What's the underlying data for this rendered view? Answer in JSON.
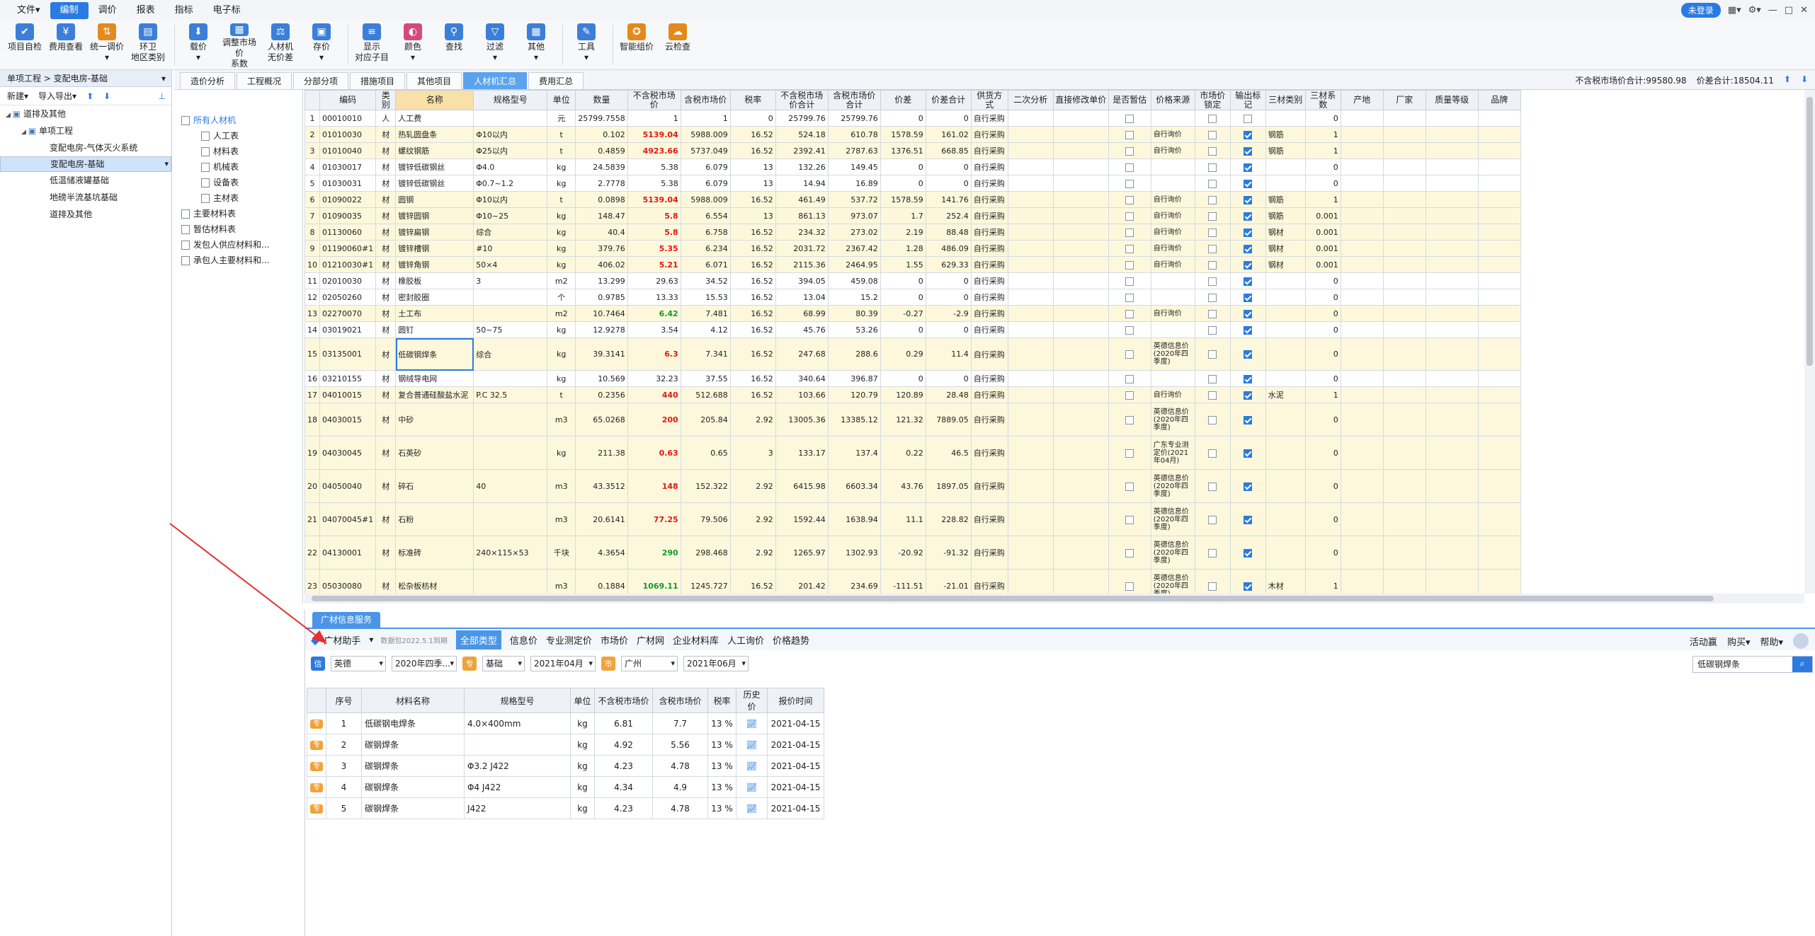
{
  "menubar": {
    "items": [
      "文件▾",
      "编制",
      "调价",
      "报表",
      "指标",
      "电子标"
    ],
    "active_index": 1,
    "login": "未登录"
  },
  "ribbon": {
    "buttons": [
      {
        "label": "项目自检",
        "icon": "check-icon",
        "color": "#3b7fd8"
      },
      {
        "label": "费用查看",
        "icon": "cost-icon",
        "color": "#3b7fd8"
      },
      {
        "label": "统一调价\n▾",
        "icon": "price-adjust-icon",
        "color": "#e28a1e"
      },
      {
        "label": "环卫\n地区类别",
        "icon": "region-icon",
        "color": "#3b7fd8"
      },
      {
        "label": "载价\n▾",
        "icon": "load-price-icon",
        "color": "#3b7fd8"
      },
      {
        "label": "调整市场价\n系数",
        "icon": "coefficient-icon",
        "color": "#3b7fd8"
      },
      {
        "label": "人材机\n无价差",
        "icon": "scale-icon",
        "color": "#3b7fd8"
      },
      {
        "label": "存价\n▾",
        "icon": "save-price-icon",
        "color": "#3b7fd8"
      },
      {
        "label": "显示\n对应子目",
        "icon": "display-icon",
        "color": "#3b7fd8"
      },
      {
        "label": "颜色\n▾",
        "icon": "color-icon",
        "color": "#d64a7a"
      },
      {
        "label": "查找",
        "icon": "binoculars-icon",
        "color": "#3b7fd8"
      },
      {
        "label": "过滤\n▾",
        "icon": "filter-icon",
        "color": "#3b7fd8"
      },
      {
        "label": "其他\n▾",
        "icon": "other-icon",
        "color": "#3b7fd8"
      },
      {
        "label": "工具\n▾",
        "icon": "tool-icon",
        "color": "#3b7fd8"
      },
      {
        "label": "智能组价",
        "icon": "smart-price-icon",
        "color": "#e28a1e"
      },
      {
        "label": "云检查",
        "icon": "cloud-check-icon",
        "color": "#e28a1e"
      }
    ]
  },
  "left": {
    "header": "单项工程 > 变配电房-基础",
    "tools": [
      "新建▾",
      "导入导出▾"
    ],
    "tree": [
      {
        "label": "道排及其他",
        "level": 0,
        "selected": false
      },
      {
        "label": "单项工程",
        "level": 1,
        "selected": false
      },
      {
        "label": "变配电房-气体灭火系统",
        "level": 2,
        "selected": false
      },
      {
        "label": "变配电房-基础",
        "level": 2,
        "selected": true
      },
      {
        "label": "低温储液罐基础",
        "level": 2,
        "selected": false
      },
      {
        "label": "地磅半流基坑基础",
        "level": 2,
        "selected": false
      },
      {
        "label": "道排及其他",
        "level": 2,
        "selected": false
      }
    ]
  },
  "tabs": {
    "items": [
      "造价分析",
      "工程概况",
      "分部分项",
      "措施项目",
      "其他项目",
      "人材机汇总",
      "费用汇总"
    ],
    "active_index": 5,
    "summary1": "不含税市场价合计:99580.98",
    "summary2": "价差合计:18504.11"
  },
  "midtree": [
    {
      "label": "所有人材机",
      "level": 0
    },
    {
      "label": "人工表",
      "level": 1
    },
    {
      "label": "材料表",
      "level": 1
    },
    {
      "label": "机械表",
      "level": 1
    },
    {
      "label": "设备表",
      "level": 1
    },
    {
      "label": "主材表",
      "level": 1
    },
    {
      "label": "主要材料表",
      "level": 0
    },
    {
      "label": "暂估材料表",
      "level": 0
    },
    {
      "label": "发包人供应材料和...",
      "level": 0
    },
    {
      "label": "承包人主要材料和...",
      "level": 0
    }
  ],
  "grid": {
    "headers": [
      "",
      "编码",
      "类别",
      "名称",
      "规格型号",
      "单位",
      "数量",
      "不含税市场价",
      "含税市场价",
      "税率",
      "不含税市场价合计",
      "含税市场价合计",
      "价差",
      "价差合计",
      "供货方式",
      "二次分析",
      "直接修改单价",
      "是否暂估",
      "价格来源",
      "市场价锁定",
      "输出标记",
      "三材类别",
      "三材系数",
      "产地",
      "厂家",
      "质量等级",
      "品牌"
    ],
    "rows": [
      {
        "n": "1",
        "code": "00010010",
        "cat": "人",
        "name": "人工费",
        "spec": "",
        "unit": "元",
        "qty": "25799.7558",
        "p1": "1",
        "p1c": "",
        "p2": "1",
        "tax": "0",
        "s1": "25799.76",
        "s2": "25799.76",
        "d": "0",
        "dt": "0",
        "sup": "自行采购",
        "src": "",
        "flag": false,
        "mat": "",
        "coef": "0",
        "y": false,
        "h": 23
      },
      {
        "n": "2",
        "code": "01010030",
        "cat": "材",
        "name": "热轧圆盘条",
        "spec": "Φ10以内",
        "unit": "t",
        "qty": "0.102",
        "p1": "5139.04",
        "p1c": "red",
        "p2": "5988.009",
        "tax": "16.52",
        "s1": "524.18",
        "s2": "610.78",
        "d": "1578.59",
        "dt": "161.02",
        "sup": "自行采购",
        "src": "自行询价",
        "flag": true,
        "mat": "钢筋",
        "coef": "1",
        "y": true,
        "h": 23
      },
      {
        "n": "3",
        "code": "01010040",
        "cat": "材",
        "name": "螺纹钢筋",
        "spec": "Φ25以内",
        "unit": "t",
        "qty": "0.4859",
        "p1": "4923.66",
        "p1c": "red",
        "p2": "5737.049",
        "tax": "16.52",
        "s1": "2392.41",
        "s2": "2787.63",
        "d": "1376.51",
        "dt": "668.85",
        "sup": "自行采购",
        "src": "自行询价",
        "flag": true,
        "mat": "钢筋",
        "coef": "1",
        "y": true,
        "h": 23
      },
      {
        "n": "4",
        "code": "01030017",
        "cat": "材",
        "name": "镀锌低碳钢丝",
        "spec": "Φ4.0",
        "unit": "kg",
        "qty": "24.5839",
        "p1": "5.38",
        "p1c": "",
        "p2": "6.079",
        "tax": "13",
        "s1": "132.26",
        "s2": "149.45",
        "d": "0",
        "dt": "0",
        "sup": "自行采购",
        "src": "",
        "flag": true,
        "mat": "",
        "coef": "0",
        "y": false,
        "h": 23
      },
      {
        "n": "5",
        "code": "01030031",
        "cat": "材",
        "name": "镀锌低碳钢丝",
        "spec": "Φ0.7~1.2",
        "unit": "kg",
        "qty": "2.7778",
        "p1": "5.38",
        "p1c": "",
        "p2": "6.079",
        "tax": "13",
        "s1": "14.94",
        "s2": "16.89",
        "d": "0",
        "dt": "0",
        "sup": "自行采购",
        "src": "",
        "flag": true,
        "mat": "",
        "coef": "0",
        "y": false,
        "h": 23
      },
      {
        "n": "6",
        "code": "01090022",
        "cat": "材",
        "name": "圆钢",
        "spec": "Φ10以内",
        "unit": "t",
        "qty": "0.0898",
        "p1": "5139.04",
        "p1c": "red",
        "p2": "5988.009",
        "tax": "16.52",
        "s1": "461.49",
        "s2": "537.72",
        "d": "1578.59",
        "dt": "141.76",
        "sup": "自行采购",
        "src": "自行询价",
        "flag": true,
        "mat": "钢筋",
        "coef": "1",
        "y": true,
        "h": 23
      },
      {
        "n": "7",
        "code": "01090035",
        "cat": "材",
        "name": "镀锌圆钢",
        "spec": "Φ10~25",
        "unit": "kg",
        "qty": "148.47",
        "p1": "5.8",
        "p1c": "red",
        "p2": "6.554",
        "tax": "13",
        "s1": "861.13",
        "s2": "973.07",
        "d": "1.7",
        "dt": "252.4",
        "sup": "自行采购",
        "src": "自行询价",
        "flag": true,
        "mat": "钢筋",
        "coef": "0.001",
        "y": true,
        "h": 23
      },
      {
        "n": "8",
        "code": "01130060",
        "cat": "材",
        "name": "镀锌扁钢",
        "spec": "综合",
        "unit": "kg",
        "qty": "40.4",
        "p1": "5.8",
        "p1c": "red",
        "p2": "6.758",
        "tax": "16.52",
        "s1": "234.32",
        "s2": "273.02",
        "d": "2.19",
        "dt": "88.48",
        "sup": "自行采购",
        "src": "自行询价",
        "flag": true,
        "mat": "钢材",
        "coef": "0.001",
        "y": true,
        "h": 23
      },
      {
        "n": "9",
        "code": "01190060#1",
        "cat": "材",
        "name": "镀锌槽钢",
        "spec": "#10",
        "unit": "kg",
        "qty": "379.76",
        "p1": "5.35",
        "p1c": "red",
        "p2": "6.234",
        "tax": "16.52",
        "s1": "2031.72",
        "s2": "2367.42",
        "d": "1.28",
        "dt": "486.09",
        "sup": "自行采购",
        "src": "自行询价",
        "flag": true,
        "mat": "钢材",
        "coef": "0.001",
        "y": true,
        "h": 23
      },
      {
        "n": "10",
        "code": "01210030#1",
        "cat": "材",
        "name": "镀锌角钢",
        "spec": "50×4",
        "unit": "kg",
        "qty": "406.02",
        "p1": "5.21",
        "p1c": "red",
        "p2": "6.071",
        "tax": "16.52",
        "s1": "2115.36",
        "s2": "2464.95",
        "d": "1.55",
        "dt": "629.33",
        "sup": "自行采购",
        "src": "自行询价",
        "flag": true,
        "mat": "钢材",
        "coef": "0.001",
        "y": true,
        "h": 23
      },
      {
        "n": "11",
        "code": "02010030",
        "cat": "材",
        "name": "橡胶板",
        "spec": "3",
        "unit": "m2",
        "qty": "13.299",
        "p1": "29.63",
        "p1c": "",
        "p2": "34.52",
        "tax": "16.52",
        "s1": "394.05",
        "s2": "459.08",
        "d": "0",
        "dt": "0",
        "sup": "自行采购",
        "src": "",
        "flag": true,
        "mat": "",
        "coef": "0",
        "y": false,
        "h": 23
      },
      {
        "n": "12",
        "code": "02050260",
        "cat": "材",
        "name": "密封胶圈",
        "spec": "",
        "unit": "个",
        "qty": "0.9785",
        "p1": "13.33",
        "p1c": "",
        "p2": "15.53",
        "tax": "16.52",
        "s1": "13.04",
        "s2": "15.2",
        "d": "0",
        "dt": "0",
        "sup": "自行采购",
        "src": "",
        "flag": true,
        "mat": "",
        "coef": "0",
        "y": false,
        "h": 23
      },
      {
        "n": "13",
        "code": "02270070",
        "cat": "材",
        "name": "土工布",
        "spec": "",
        "unit": "m2",
        "qty": "10.7464",
        "p1": "6.42",
        "p1c": "green",
        "p2": "7.481",
        "tax": "16.52",
        "s1": "68.99",
        "s2": "80.39",
        "d": "-0.27",
        "dt": "-2.9",
        "sup": "自行采购",
        "src": "自行询价",
        "flag": true,
        "mat": "",
        "coef": "0",
        "y": true,
        "h": 23
      },
      {
        "n": "14",
        "code": "03019021",
        "cat": "材",
        "name": "圆钉",
        "spec": "50~75",
        "unit": "kg",
        "qty": "12.9278",
        "p1": "3.54",
        "p1c": "",
        "p2": "4.12",
        "tax": "16.52",
        "s1": "45.76",
        "s2": "53.26",
        "d": "0",
        "dt": "0",
        "sup": "自行采购",
        "src": "",
        "flag": true,
        "mat": "",
        "coef": "0",
        "y": false,
        "h": 23
      },
      {
        "n": "15",
        "code": "03135001",
        "cat": "材",
        "name": "低碳钢焊条",
        "spec": "综合",
        "unit": "kg",
        "qty": "39.3141",
        "p1": "6.3",
        "p1c": "red",
        "p2": "7.341",
        "tax": "16.52",
        "s1": "247.68",
        "s2": "288.6",
        "d": "0.29",
        "dt": "11.4",
        "sup": "自行采购",
        "src": "英德信息价\n(2020年四\n季度)",
        "flag": true,
        "mat": "",
        "coef": "0",
        "y": true,
        "h": 46
      },
      {
        "n": "16",
        "code": "03210155",
        "cat": "材",
        "name": "钢绒导电网",
        "spec": "",
        "unit": "kg",
        "qty": "10.569",
        "p1": "32.23",
        "p1c": "",
        "p2": "37.55",
        "tax": "16.52",
        "s1": "340.64",
        "s2": "396.87",
        "d": "0",
        "dt": "0",
        "sup": "自行采购",
        "src": "",
        "flag": true,
        "mat": "",
        "coef": "0",
        "y": false,
        "h": 23
      },
      {
        "n": "17",
        "code": "04010015",
        "cat": "材",
        "name": "复合普通硅酸盐水泥",
        "spec": "P.C 32.5",
        "unit": "t",
        "qty": "0.2356",
        "p1": "440",
        "p1c": "red",
        "p2": "512.688",
        "tax": "16.52",
        "s1": "103.66",
        "s2": "120.79",
        "d": "120.89",
        "dt": "28.48",
        "sup": "自行采购",
        "src": "自行询价",
        "flag": true,
        "mat": "水泥",
        "coef": "1",
        "y": true,
        "h": 23
      },
      {
        "n": "18",
        "code": "04030015",
        "cat": "材",
        "name": "中砂",
        "spec": "",
        "unit": "m3",
        "qty": "65.0268",
        "p1": "200",
        "p1c": "red",
        "p2": "205.84",
        "tax": "2.92",
        "s1": "13005.36",
        "s2": "13385.12",
        "d": "121.32",
        "dt": "7889.05",
        "sup": "自行采购",
        "src": "英德信息价\n(2020年四\n季度)",
        "flag": true,
        "mat": "",
        "coef": "0",
        "y": true,
        "h": 47
      },
      {
        "n": "19",
        "code": "04030045",
        "cat": "材",
        "name": "石英砂",
        "spec": "",
        "unit": "kg",
        "qty": "211.38",
        "p1": "0.63",
        "p1c": "red",
        "p2": "0.65",
        "tax": "3",
        "s1": "133.17",
        "s2": "137.4",
        "d": "0.22",
        "dt": "46.5",
        "sup": "自行采购",
        "src": "广东专业测\n定价(2021\n年04月)",
        "flag": true,
        "mat": "",
        "coef": "0",
        "y": true,
        "h": 47
      },
      {
        "n": "20",
        "code": "04050040",
        "cat": "材",
        "name": "碎石",
        "spec": "40",
        "unit": "m3",
        "qty": "43.3512",
        "p1": "148",
        "p1c": "red",
        "p2": "152.322",
        "tax": "2.92",
        "s1": "6415.98",
        "s2": "6603.34",
        "d": "43.76",
        "dt": "1897.05",
        "sup": "自行采购",
        "src": "英德信息价\n(2020年四\n季度)",
        "flag": true,
        "mat": "",
        "coef": "0",
        "y": true,
        "h": 47
      },
      {
        "n": "21",
        "code": "04070045#1",
        "cat": "材",
        "name": "石粉",
        "spec": "",
        "unit": "m3",
        "qty": "20.6141",
        "p1": "77.25",
        "p1c": "red",
        "p2": "79.506",
        "tax": "2.92",
        "s1": "1592.44",
        "s2": "1638.94",
        "d": "11.1",
        "dt": "228.82",
        "sup": "自行采购",
        "src": "英德信息价\n(2020年四\n季度)",
        "flag": true,
        "mat": "",
        "coef": "0",
        "y": true,
        "h": 47
      },
      {
        "n": "22",
        "code": "04130001",
        "cat": "材",
        "name": "标准砖",
        "spec": "240×115×53",
        "unit": "千块",
        "qty": "4.3654",
        "p1": "290",
        "p1c": "green",
        "p2": "298.468",
        "tax": "2.92",
        "s1": "1265.97",
        "s2": "1302.93",
        "d": "-20.92",
        "dt": "-91.32",
        "sup": "自行采购",
        "src": "英德信息价\n(2020年四\n季度)",
        "flag": true,
        "mat": "",
        "coef": "0",
        "y": true,
        "h": 47
      },
      {
        "n": "23",
        "code": "05030080",
        "cat": "材",
        "name": "松杂板枋材",
        "spec": "",
        "unit": "m3",
        "qty": "0.1884",
        "p1": "1069.11",
        "p1c": "green",
        "p2": "1245.727",
        "tax": "16.52",
        "s1": "201.42",
        "s2": "234.69",
        "d": "-111.51",
        "dt": "-21.01",
        "sup": "自行采购",
        "src": "英德信息价\n(2020年四\n季度)",
        "flag": true,
        "mat": "木材",
        "coef": "1",
        "y": true,
        "h": 47
      }
    ]
  },
  "bottom": {
    "tab": "广材信息服务",
    "assistant": "广材助手",
    "data_pkg": "数据包2022.5.1到期",
    "types": [
      "全部类型",
      "信息价",
      "专业测定价",
      "市场价",
      "广材网",
      "企业材料库",
      "人工询价",
      "价格趋势"
    ],
    "active_type": 0,
    "right_items": [
      "活动赢",
      "购买▾",
      "帮助▾"
    ],
    "filters": {
      "region": "英德",
      "period": "2020年四季...",
      "kind": "基础",
      "from": "2021年04月",
      "city": "广州",
      "to": "2021年06月"
    },
    "search": "低碳钢焊条",
    "result_headers": [
      "序号",
      "材料名称",
      "规格型号",
      "单位",
      "不含税市场价",
      "含税市场价",
      "税率",
      "历史价",
      "报价时间"
    ],
    "results": [
      {
        "n": "1",
        "name": "低碳钢电焊条",
        "spec": "4.0×400mm",
        "unit": "kg",
        "p1": "6.81",
        "p2": "7.7",
        "tax": "13 %",
        "date": "2021-04-15"
      },
      {
        "n": "2",
        "name": "碳钢焊条",
        "spec": "",
        "unit": "kg",
        "p1": "4.92",
        "p2": "5.56",
        "tax": "13 %",
        "date": "2021-04-15"
      },
      {
        "n": "3",
        "name": "碳钢焊条",
        "spec": "Φ3.2 J422",
        "unit": "kg",
        "p1": "4.23",
        "p2": "4.78",
        "tax": "13 %",
        "date": "2021-04-15"
      },
      {
        "n": "4",
        "name": "碳钢焊条",
        "spec": "Φ4 J422",
        "unit": "kg",
        "p1": "4.34",
        "p2": "4.9",
        "tax": "13 %",
        "date": "2021-04-15"
      },
      {
        "n": "5",
        "name": "碳钢焊条",
        "spec": "J422",
        "unit": "kg",
        "p1": "4.23",
        "p2": "4.78",
        "tax": "13 %",
        "date": "2021-04-15"
      }
    ]
  },
  "colors": {
    "accent": "#2a7ae2",
    "highlight_row": "#fdf8dc",
    "name_header": "#f9dfa8",
    "arrow": "#e53030"
  }
}
